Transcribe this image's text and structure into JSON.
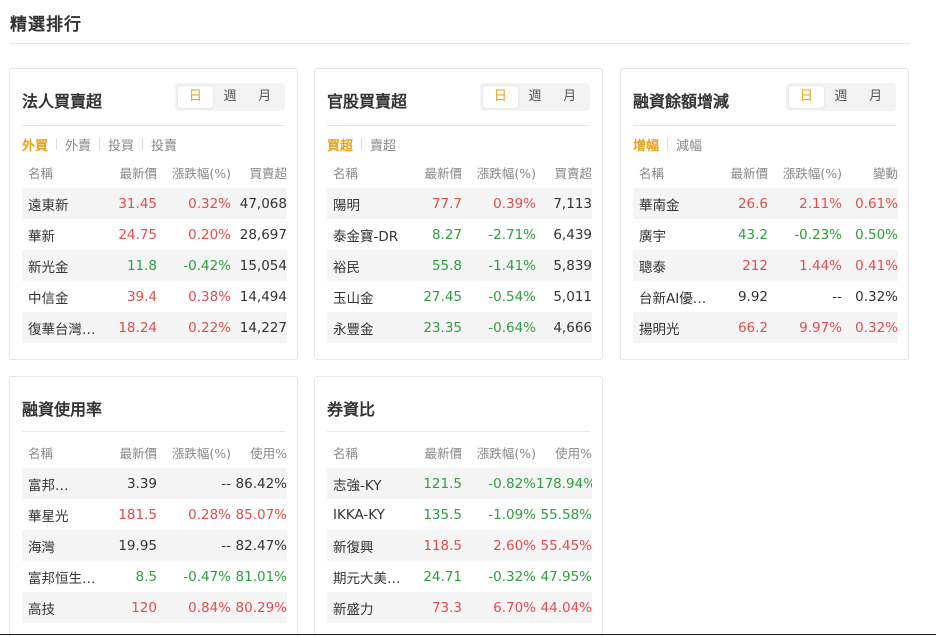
{
  "page": {
    "title": "精選排行"
  },
  "colors": {
    "up": "#e34d4d",
    "down": "#2f9e3e",
    "accent": "#e8a317"
  },
  "cards": [
    {
      "title": "法人買賣超",
      "periods": [
        "日",
        "週",
        "月"
      ],
      "subtabs": [
        "外買",
        "外賣",
        "投買",
        "投賣"
      ],
      "headers": [
        "名稱",
        "最新價",
        "漲跌幅(%)",
        "買賣超"
      ],
      "rows": [
        {
          "name": "遠東新",
          "price": "31.45",
          "change": "0.32%",
          "last": "47,068",
          "dir": "up",
          "last_dir": "flat"
        },
        {
          "name": "華新",
          "price": "24.75",
          "change": "0.20%",
          "last": "28,697",
          "dir": "up",
          "last_dir": "flat"
        },
        {
          "name": "新光金",
          "price": "11.8",
          "change": "-0.42%",
          "last": "15,054",
          "dir": "down",
          "last_dir": "flat"
        },
        {
          "name": "中信金",
          "price": "39.4",
          "change": "0.38%",
          "last": "14,494",
          "dir": "up",
          "last_dir": "flat"
        },
        {
          "name": "復華台灣…",
          "price": "18.24",
          "change": "0.22%",
          "last": "14,227",
          "dir": "up",
          "last_dir": "flat"
        }
      ]
    },
    {
      "title": "官股買賣超",
      "periods": [
        "日",
        "週",
        "月"
      ],
      "subtabs": [
        "買超",
        "賣超"
      ],
      "headers": [
        "名稱",
        "最新價",
        "漲跌幅(%)",
        "買賣超"
      ],
      "rows": [
        {
          "name": "陽明",
          "price": "77.7",
          "change": "0.39%",
          "last": "7,113",
          "dir": "up",
          "last_dir": "flat"
        },
        {
          "name": "泰金寶-DR",
          "price": "8.27",
          "change": "-2.71%",
          "last": "6,439",
          "dir": "down",
          "last_dir": "flat"
        },
        {
          "name": "裕民",
          "price": "55.8",
          "change": "-1.41%",
          "last": "5,839",
          "dir": "down",
          "last_dir": "flat"
        },
        {
          "name": "玉山金",
          "price": "27.45",
          "change": "-0.54%",
          "last": "5,011",
          "dir": "down",
          "last_dir": "flat"
        },
        {
          "name": "永豐金",
          "price": "23.35",
          "change": "-0.64%",
          "last": "4,666",
          "dir": "down",
          "last_dir": "flat"
        }
      ]
    },
    {
      "title": "融資餘額增減",
      "periods": [
        "日",
        "週",
        "月"
      ],
      "subtabs": [
        "增幅",
        "減幅"
      ],
      "headers": [
        "名稱",
        "最新價",
        "漲跌幅(%)",
        "變動"
      ],
      "rows": [
        {
          "name": "華南金",
          "price": "26.6",
          "change": "2.11%",
          "last": "0.61%",
          "dir": "up",
          "last_dir": "up"
        },
        {
          "name": "廣宇",
          "price": "43.2",
          "change": "-0.23%",
          "last": "0.50%",
          "dir": "down",
          "last_dir": "down"
        },
        {
          "name": "聰泰",
          "price": "212",
          "change": "1.44%",
          "last": "0.41%",
          "dir": "up",
          "last_dir": "up"
        },
        {
          "name": "台新AI優…",
          "price": "9.92",
          "change": "--",
          "last": "0.32%",
          "dir": "flat",
          "last_dir": "flat"
        },
        {
          "name": "揚明光",
          "price": "66.2",
          "change": "9.97%",
          "last": "0.32%",
          "dir": "up",
          "last_dir": "up"
        }
      ]
    },
    {
      "title": "融資使用率",
      "headers": [
        "名稱",
        "最新價",
        "漲跌幅(%)",
        "使用%"
      ],
      "rows": [
        {
          "name": "富邦…",
          "price": "3.39",
          "change": "--",
          "last": "86.42%",
          "dir": "flat",
          "last_dir": "flat"
        },
        {
          "name": "華星光",
          "price": "181.5",
          "change": "0.28%",
          "last": "85.07%",
          "dir": "up",
          "last_dir": "up"
        },
        {
          "name": "海灣",
          "price": "19.95",
          "change": "--",
          "last": "82.47%",
          "dir": "flat",
          "last_dir": "flat"
        },
        {
          "name": "富邦恒生…",
          "price": "8.5",
          "change": "-0.47%",
          "last": "81.01%",
          "dir": "down",
          "last_dir": "down"
        },
        {
          "name": "高技",
          "price": "120",
          "change": "0.84%",
          "last": "80.29%",
          "dir": "up",
          "last_dir": "up"
        }
      ]
    },
    {
      "title": "券資比",
      "headers": [
        "名稱",
        "最新價",
        "漲跌幅(%)",
        "使用%"
      ],
      "rows": [
        {
          "name": "志強-KY",
          "price": "121.5",
          "change": "-0.82%",
          "last": "178.94%",
          "dir": "down",
          "last_dir": "down"
        },
        {
          "name": "IKKA-KY",
          "price": "135.5",
          "change": "-1.09%",
          "last": "55.58%",
          "dir": "down",
          "last_dir": "down"
        },
        {
          "name": "新復興",
          "price": "118.5",
          "change": "2.60%",
          "last": "55.45%",
          "dir": "up",
          "last_dir": "up"
        },
        {
          "name": "期元大美…",
          "price": "24.71",
          "change": "-0.32%",
          "last": "47.95%",
          "dir": "down",
          "last_dir": "down"
        },
        {
          "name": "新盛力",
          "price": "73.3",
          "change": "6.70%",
          "last": "44.04%",
          "dir": "up",
          "last_dir": "up"
        }
      ]
    }
  ]
}
